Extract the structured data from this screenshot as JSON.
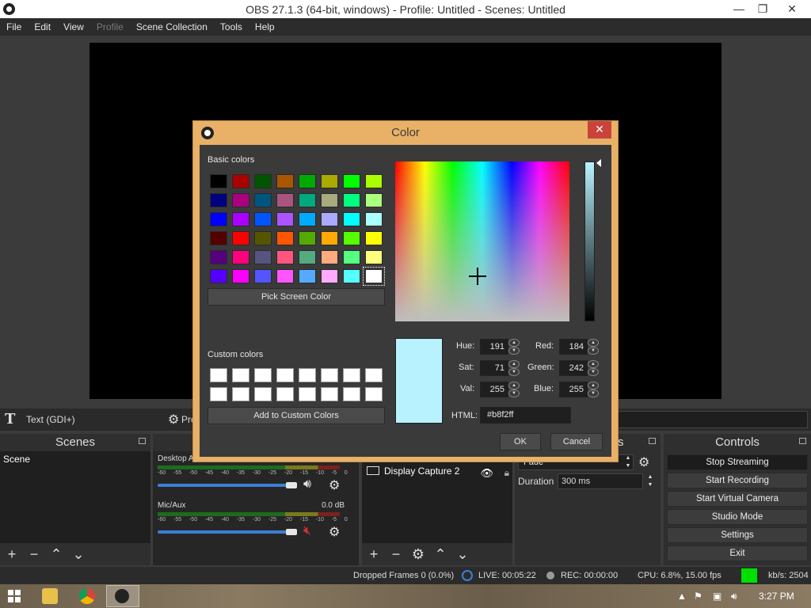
{
  "window": {
    "title": "OBS 27.1.3 (64-bit, windows) - Profile: Untitled - Scenes: Untitled",
    "minimize_glyph": "—",
    "restore_glyph": "❐",
    "close_glyph": "✕"
  },
  "menu": [
    "File",
    "Edit",
    "View",
    "Profile",
    "Scene Collection",
    "Tools",
    "Help"
  ],
  "source_toolbar": {
    "source_name": "Text (GDI+)",
    "properties_label": "Pro"
  },
  "docks": {
    "scenes": {
      "title": "Scenes",
      "items": [
        "Scene"
      ]
    },
    "controls": {
      "title": "Controls"
    },
    "transitions_partial_title": "s"
  },
  "mixer": {
    "channels": [
      {
        "name": "Desktop A",
        "db": ""
      },
      {
        "name": "Mic/Aux",
        "db": "0.0 dB"
      }
    ],
    "ticks": [
      "-60",
      "-55",
      "-50",
      "-45",
      "-40",
      "-35",
      "-30",
      "-25",
      "-20",
      "-15",
      "-10",
      "-5",
      "0"
    ]
  },
  "sources": {
    "items": [
      {
        "name": "Display Capture 2"
      }
    ]
  },
  "transitions": {
    "selected": "Fade",
    "duration_label": "Duration",
    "duration_value": "300 ms"
  },
  "controls": {
    "buttons": [
      "Stop Streaming",
      "Start Recording",
      "Start Virtual Camera",
      "Studio Mode",
      "Settings",
      "Exit"
    ]
  },
  "status": {
    "dropped_frames": "Dropped Frames 0 (0.0%)",
    "live": "LIVE: 00:05:22",
    "rec": "REC: 00:00:00",
    "cpu": "CPU: 6.8%, 15.00 fps",
    "kbps": "kb/s: 2504",
    "streaming_health_color": "#00e000"
  },
  "taskbar": {
    "clock": "3:27 PM"
  },
  "dialog": {
    "title": "Color",
    "basic_colors_label": "Basic colors",
    "basic_colors": [
      "#000000",
      "#aa0000",
      "#005500",
      "#aa5500",
      "#00aa00",
      "#aaaa00",
      "#00ff00",
      "#aaff00",
      "#00007f",
      "#aa007f",
      "#00557f",
      "#aa557f",
      "#00aa7f",
      "#aaaa7f",
      "#00ff7f",
      "#aaff7f",
      "#0000ff",
      "#aa00ff",
      "#0055ff",
      "#aa55ff",
      "#00aaff",
      "#aaaaff",
      "#00ffff",
      "#aaffff",
      "#550000",
      "#ff0000",
      "#555500",
      "#ff5500",
      "#55aa00",
      "#ffaa00",
      "#55ff00",
      "#ffff00",
      "#55007f",
      "#ff007f",
      "#55557f",
      "#ff557f",
      "#55aa7f",
      "#ffaa7f",
      "#55ff7f",
      "#ffff7f",
      "#5500ff",
      "#ff00ff",
      "#5555ff",
      "#ff55ff",
      "#55aaff",
      "#ffaaff",
      "#55ffff",
      "#ffffff"
    ],
    "selected_basic_index": 47,
    "pick_screen_label": "Pick Screen Color",
    "custom_colors_label": "Custom colors",
    "add_custom_label": "Add to Custom Colors",
    "hue_label": "Hue:",
    "hue": "191",
    "sat_label": "Sat:",
    "sat": "71",
    "val_label": "Val:",
    "val": "255",
    "red_label": "Red:",
    "red": "184",
    "green_label": "Green:",
    "green": "242",
    "blue_label": "Blue:",
    "blue": "255",
    "html_label": "HTML:",
    "html": "#b8f2ff",
    "current_color": "#b8f2ff",
    "ok_label": "OK",
    "cancel_label": "Cancel"
  }
}
